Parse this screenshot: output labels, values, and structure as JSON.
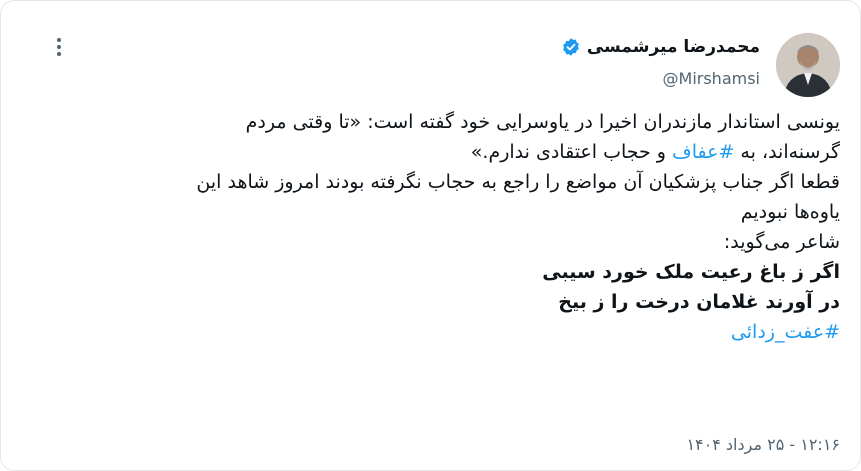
{
  "author": {
    "display_name": "محمدرضا میرشمسی",
    "handle": "@Mirshamsi",
    "verified": true
  },
  "tweet": {
    "line1": "یونسی استاندار مازندران اخیرا در یاوسرایی خود گفته است: «تا وقتی مردم",
    "line2_before": "گرسنه‌اند، به ",
    "line2_hashtag": "#عفاف",
    "line2_after": " و حجاب اعتقادی ندارم.»",
    "line3": "قطعا اگر جناب پزشکیان آن مواضع را راجع به حجاب نگرفته بودند امروز شاهد این",
    "line4": "یاوه‌ها نبودیم",
    "line5": "شاعر می‌گوید:",
    "verse1": "اگر ز باغ رعیت ملک خورد سیبی",
    "verse2": "در آورند غلامان درخت را ز بیخ",
    "closing_hashtag": "#عفت_زدائی"
  },
  "timestamp": "۱۲:۱۶ - ۲۵ مرداد ۱۴۰۴",
  "colors": {
    "link": "#1d9bf0",
    "verified_badge": "#1d9bf0",
    "secondary_text": "#536471"
  },
  "icons": {
    "more": "more-options-icon",
    "verified": "verified-badge-icon"
  }
}
